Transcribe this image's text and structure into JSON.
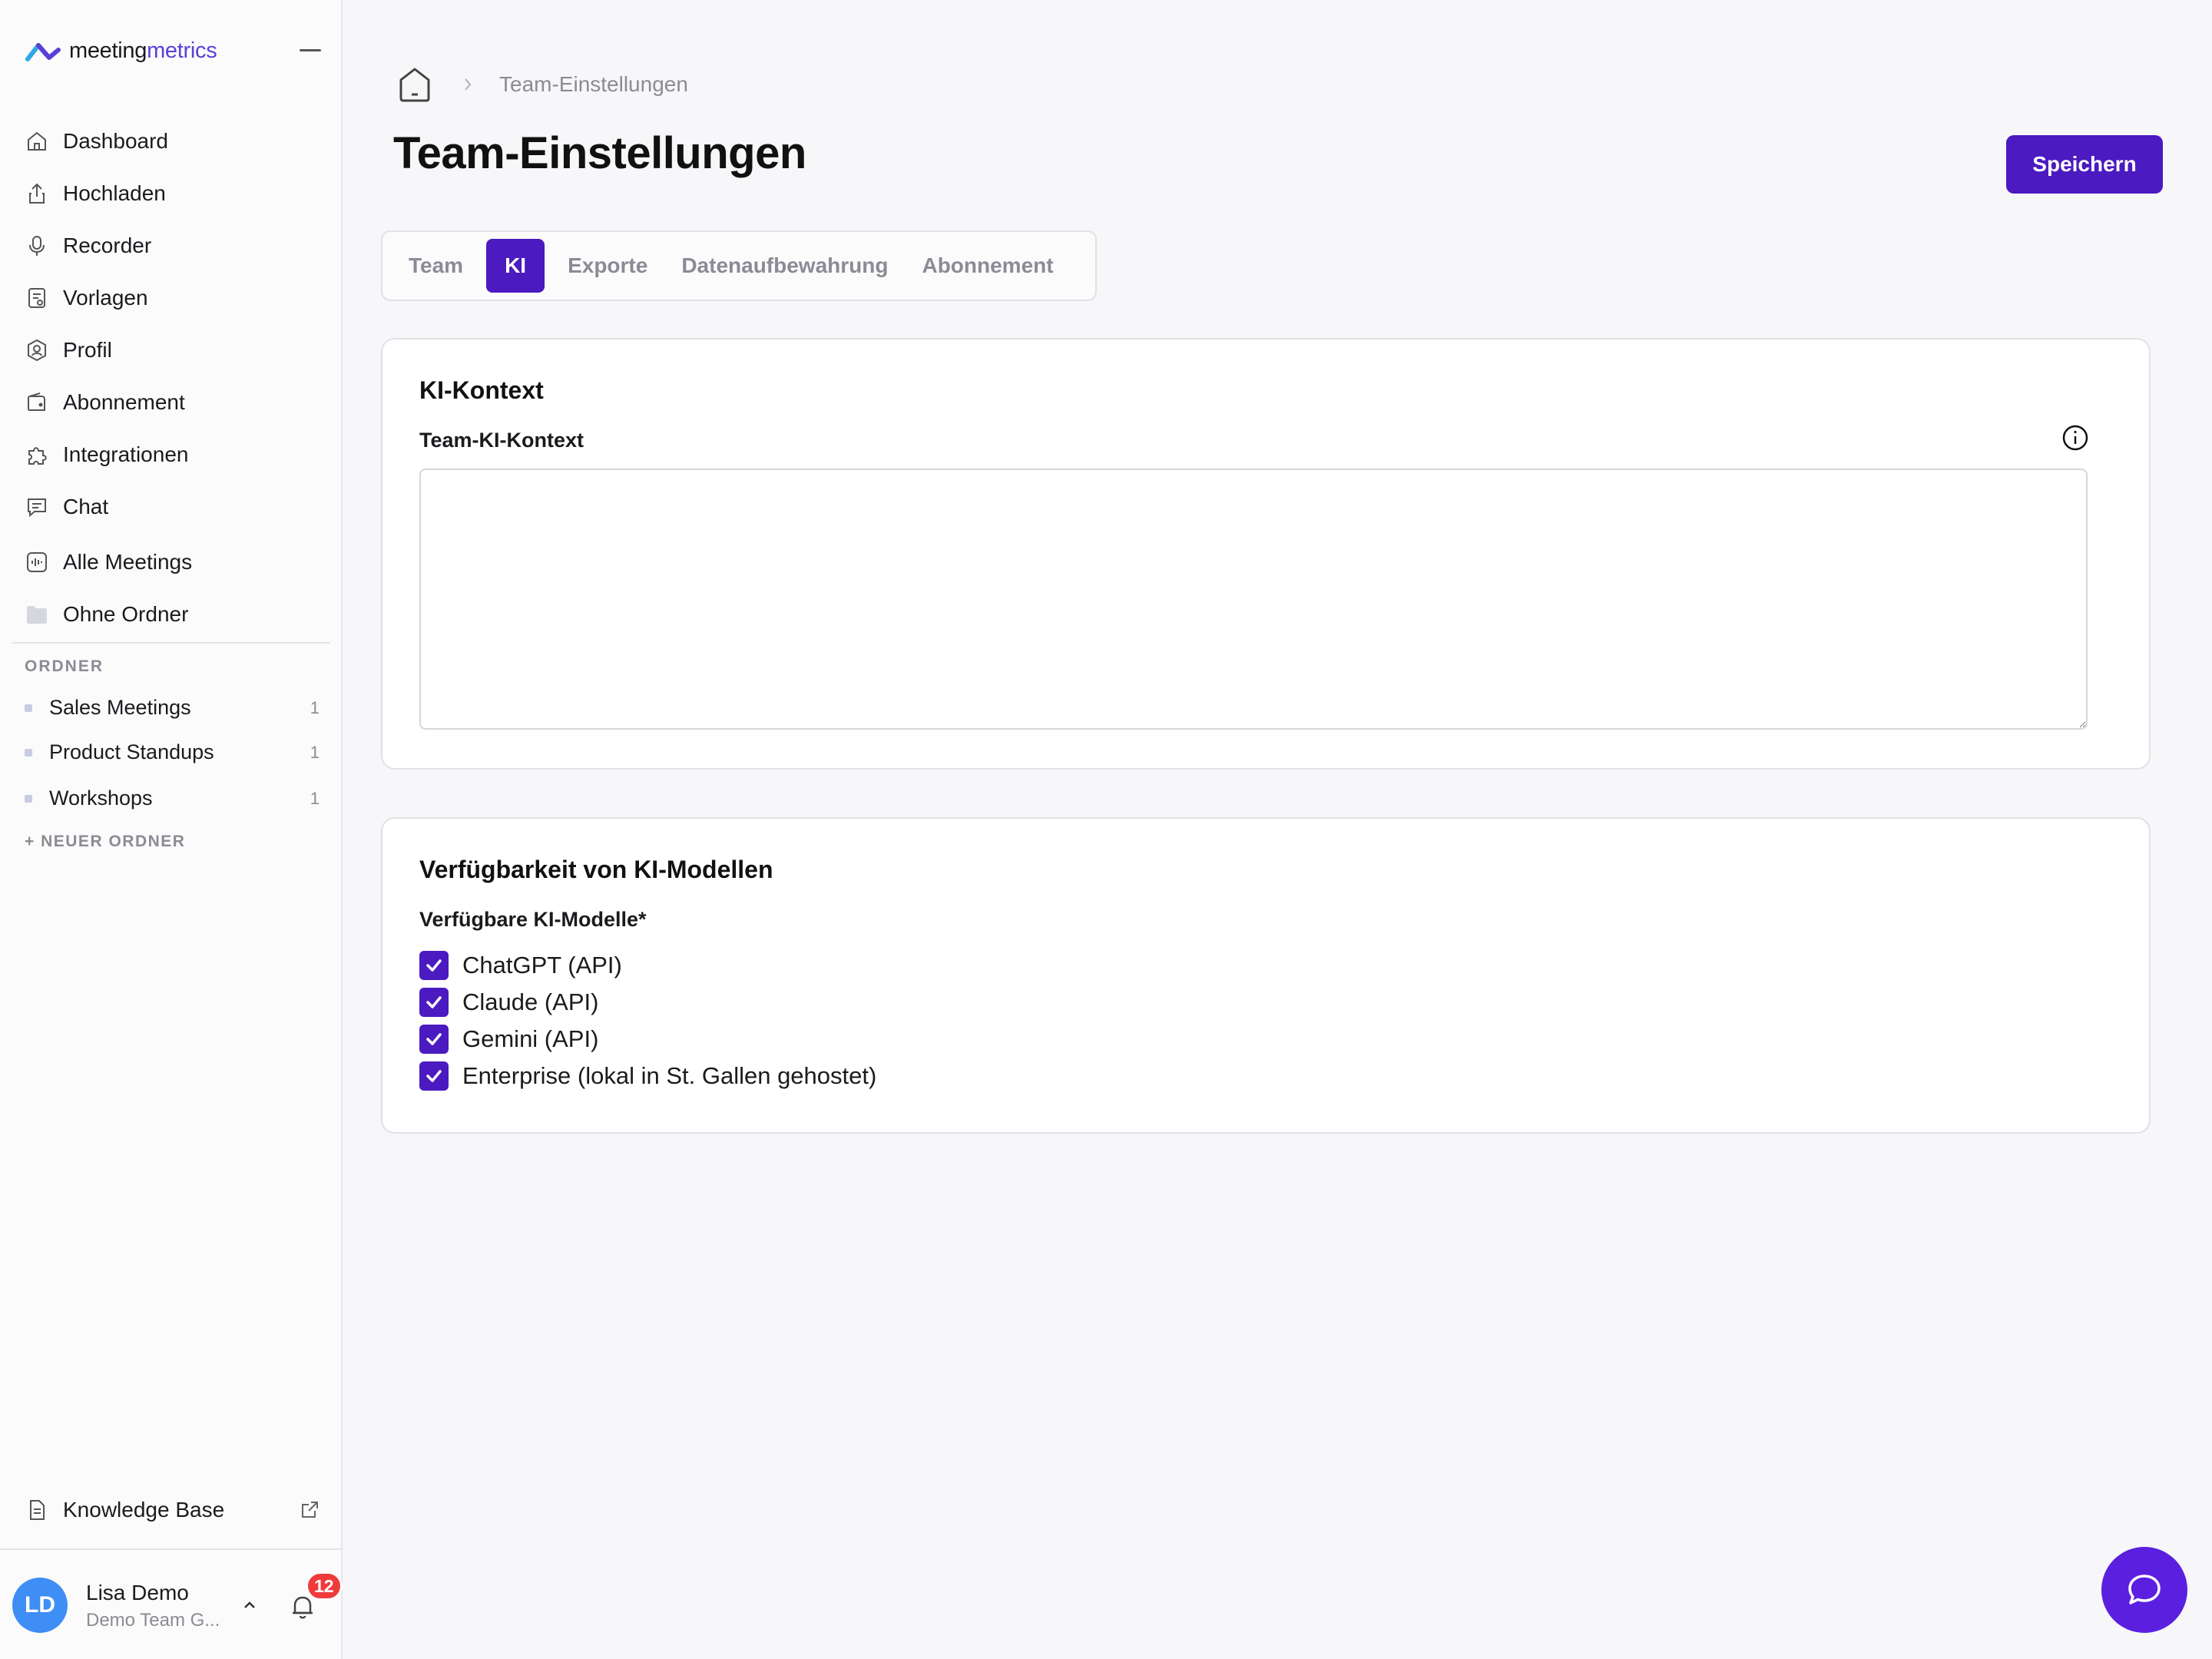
{
  "brand": {
    "prefix": "meeting",
    "accent": "metrics"
  },
  "sidebar": {
    "nav": [
      {
        "label": "Dashboard",
        "icon": "home-icon"
      },
      {
        "label": "Hochladen",
        "icon": "upload-icon"
      },
      {
        "label": "Recorder",
        "icon": "microphone-icon"
      },
      {
        "label": "Vorlagen",
        "icon": "template-icon"
      },
      {
        "label": "Profil",
        "icon": "profile-icon"
      },
      {
        "label": "Abonnement",
        "icon": "wallet-icon"
      },
      {
        "label": "Integrationen",
        "icon": "puzzle-icon"
      },
      {
        "label": "Chat",
        "icon": "chat-icon"
      },
      {
        "label": "Alle Meetings",
        "icon": "audio-wave-icon"
      },
      {
        "label": "Ohne Ordner",
        "icon": "folder-icon"
      }
    ],
    "folders_title": "ORDNER",
    "folders": [
      {
        "name": "Sales Meetings",
        "count": "1"
      },
      {
        "name": "Product Standups",
        "count": "1"
      },
      {
        "name": "Workshops",
        "count": "1"
      }
    ],
    "new_folder": "+ NEUER ORDNER",
    "knowledge_base": "Knowledge Base",
    "user": {
      "initials": "LD",
      "name": "Lisa Demo",
      "team": "Demo Team G...",
      "notifications": "12"
    }
  },
  "breadcrumb": {
    "current": "Team-Einstellungen"
  },
  "page_title": "Team-Einstellungen",
  "save_label": "Speichern",
  "tabs": [
    {
      "label": "Team",
      "active": false
    },
    {
      "label": "KI",
      "active": true
    },
    {
      "label": "Exporte",
      "active": false
    },
    {
      "label": "Datenaufbewahrung",
      "active": false
    },
    {
      "label": "Abonnement",
      "active": false
    }
  ],
  "ai_context": {
    "title": "KI-Kontext",
    "field_label": "Team-KI-Kontext",
    "value": ""
  },
  "ai_models": {
    "title": "Verfügbarkeit von KI-Modellen",
    "field_label": "Verfügbare KI-Modelle*",
    "options": [
      {
        "label": "ChatGPT (API)",
        "checked": true
      },
      {
        "label": "Claude (API)",
        "checked": true
      },
      {
        "label": "Gemini (API)",
        "checked": true
      },
      {
        "label": "Enterprise (lokal in St. Gallen gehostet)",
        "checked": true
      }
    ]
  },
  "colors": {
    "accent": "#4b1ac0",
    "badge": "#ef3b3b",
    "avatar": "#3f8ef5",
    "chat_fab": "#5b1fe0"
  }
}
